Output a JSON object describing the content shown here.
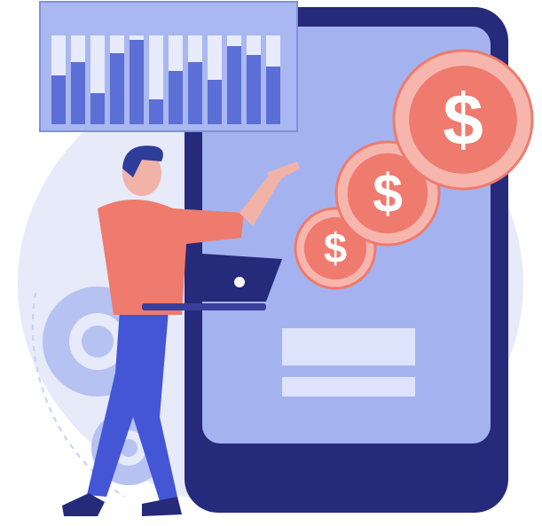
{
  "illustration": {
    "coins": [
      {
        "symbol": "$"
      },
      {
        "symbol": "$"
      },
      {
        "symbol": "$"
      }
    ],
    "chart_panel": {
      "bars": [
        {
          "value": 0.55
        },
        {
          "value": 0.7
        },
        {
          "value": 0.35
        },
        {
          "value": 0.8
        },
        {
          "value": 0.95
        },
        {
          "value": 0.28
        },
        {
          "value": 0.6
        },
        {
          "value": 0.7
        },
        {
          "value": 0.5
        },
        {
          "value": 0.88
        },
        {
          "value": 0.78
        },
        {
          "value": 0.65
        }
      ]
    },
    "colors": {
      "bg_blob": "#e6eaf9",
      "phone_frame": "#262a7a",
      "phone_screen": "#a4b3ef",
      "coin_outer": "#f7b6ad",
      "coin_inner": "#ef7a6e",
      "dollar": "#ffffff",
      "chart_bg": "#a9b8f0",
      "bar_fill": "#5c6fd6",
      "bar_track": "#e7ebfb",
      "shirt": "#ef7a6e",
      "skin": "#f1b3a8",
      "hair": "#2f3d9a",
      "pants": "#4456d6",
      "laptop": "#262a7a",
      "gear": "#b5c2f2",
      "button_bar": "#dde3fb"
    }
  }
}
